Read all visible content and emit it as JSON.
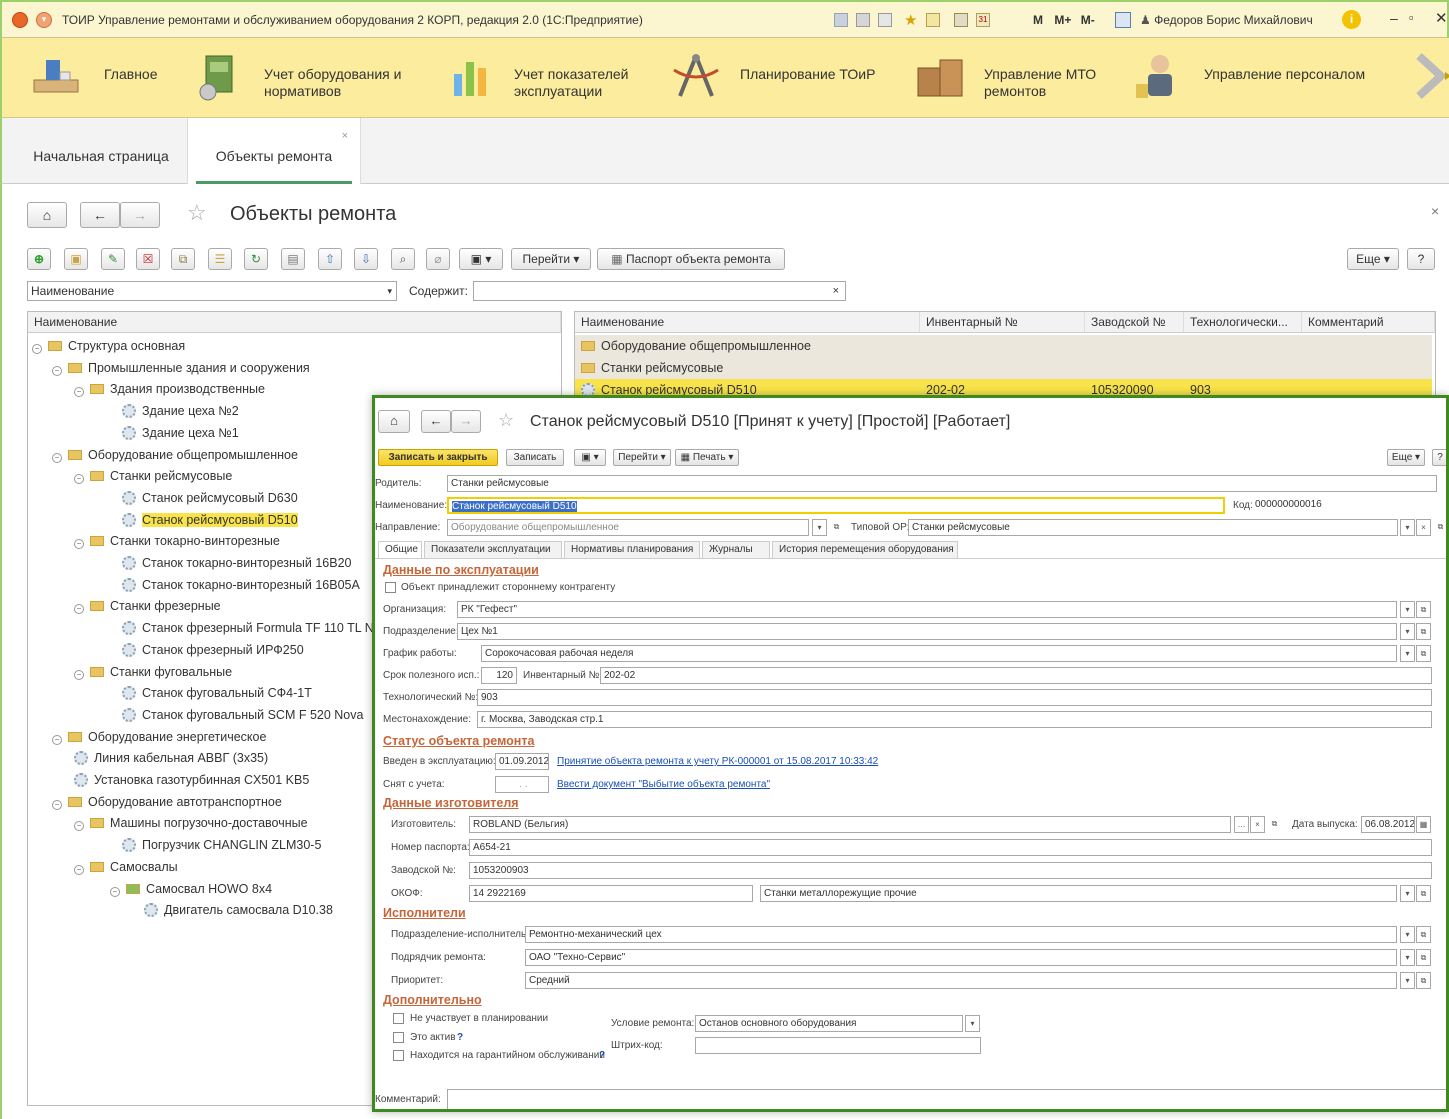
{
  "window": {
    "title": "ТОИР Управление ремонтами и обслуживанием оборудования 2 КОРП, редакция 2.0  (1С:Предприятие)",
    "user": "Федоров Борис Михайлович",
    "quick_buttons": [
      "M",
      "M+",
      "M-"
    ]
  },
  "sections": [
    {
      "label": "Главное"
    },
    {
      "label": "Учет оборудования и\nнормативов"
    },
    {
      "label": "Учет показателей\nэксплуатации"
    },
    {
      "label": "Планирование ТОиР"
    },
    {
      "label": "Управление МТО\nремонтов"
    },
    {
      "label": "Управление персоналом"
    }
  ],
  "tabs": [
    {
      "label": "Начальная страница"
    },
    {
      "label": "Объекты ремонта"
    }
  ],
  "page": {
    "title": "Объекты ремонта",
    "goto_button": "Перейти",
    "passport_button": "Паспорт объекта ремонта",
    "more_button": "Еще",
    "help_button": "?",
    "search_field": "Наименование",
    "contains_label": "Содержит:"
  },
  "tree": {
    "header": "Наименование",
    "items": [
      {
        "label": "Структура основная",
        "level": 0,
        "type": "root"
      },
      {
        "label": "Промышленные здания и сооружения",
        "level": 1,
        "type": "folder"
      },
      {
        "label": "Здания производственные",
        "level": 2,
        "type": "folder"
      },
      {
        "label": "Здание цеха №2",
        "level": 3,
        "type": "item"
      },
      {
        "label": "Здание цеха №1",
        "level": 3,
        "type": "item"
      },
      {
        "label": "Оборудование общепромышленное",
        "level": 1,
        "type": "folder"
      },
      {
        "label": "Станки рейсмусовые",
        "level": 2,
        "type": "folder"
      },
      {
        "label": "Станок рейсмусовый D630",
        "level": 3,
        "type": "item"
      },
      {
        "label": "Станок рейсмусовый D510",
        "level": 3,
        "type": "item",
        "selected": true
      },
      {
        "label": "Станки токарно-винторезные",
        "level": 2,
        "type": "folder"
      },
      {
        "label": "Станок токарно-винторезный 16В20",
        "level": 3,
        "type": "item"
      },
      {
        "label": "Станок токарно-винторезный 16В05А",
        "level": 3,
        "type": "item"
      },
      {
        "label": "Станки фрезерные",
        "level": 2,
        "type": "folder"
      },
      {
        "label": "Станок фрезерный Formula TF 110 TL N",
        "level": 3,
        "type": "item"
      },
      {
        "label": "Станок фрезерный ИРФ250",
        "level": 3,
        "type": "item"
      },
      {
        "label": "Станки фуговальные",
        "level": 2,
        "type": "folder"
      },
      {
        "label": "Станок фуговальный СФ4-1Т",
        "level": 3,
        "type": "item"
      },
      {
        "label": "Станок фуговальный SCM F 520 Nova",
        "level": 3,
        "type": "item"
      },
      {
        "label": "Оборудование энергетическое",
        "level": 1,
        "type": "folder"
      },
      {
        "label": "Линия кабельная АВВГ (3х35)",
        "level": 2,
        "type": "item"
      },
      {
        "label": "Установка газотурбинная CX501 KB5",
        "level": 2,
        "type": "item"
      },
      {
        "label": "Оборудование автотранспортное",
        "level": 1,
        "type": "folder"
      },
      {
        "label": "Машины погрузочно-доставочные",
        "level": 2,
        "type": "folder"
      },
      {
        "label": "Погрузчик CHANGLIN ZLM30-5",
        "level": 3,
        "type": "item"
      },
      {
        "label": "Самосвалы",
        "level": 2,
        "type": "folder"
      },
      {
        "label": "Самосвал HOWO 8x4",
        "level": 3,
        "type": "vehicle"
      },
      {
        "label": "Двигатель самосвала D10.38",
        "level": 4,
        "type": "item"
      }
    ]
  },
  "list": {
    "headers": [
      "Наименование",
      "Инвентарный №",
      "Заводской №",
      "Технологически...",
      "Комментарий"
    ],
    "rows": [
      {
        "name": "Оборудование общепромышленное",
        "inv": "",
        "factory": "",
        "tech": "",
        "comment": "",
        "type": "folder"
      },
      {
        "name": "Станки рейсмусовые",
        "inv": "",
        "factory": "",
        "tech": "",
        "comment": "",
        "type": "folder"
      },
      {
        "name": "Станок рейсмусовый D510",
        "inv": "202-02",
        "factory": "105320090",
        "tech": "903",
        "comment": "",
        "type": "item",
        "selected": true
      }
    ]
  },
  "form": {
    "title": "Станок рейсмусовый D510 [Принят к учету] [Простой] [Работает]",
    "save_close": "Записать и закрыть",
    "save": "Записать",
    "goto": "Перейти",
    "print": "Печать",
    "more": "Еще",
    "help": "?",
    "parent_label": "Родитель:",
    "parent_value": "Станки рейсмусовые",
    "name_label": "Наименование:",
    "name_value": "Станок рейсмусовый D510",
    "code_label": "Код:",
    "code_value": "000000000016",
    "direction_label": "Направление:",
    "direction_value": "Оборудование общепромышленное",
    "typical_label": "Типовой ОР:",
    "typical_value": "Станки рейсмусовые",
    "tabs": [
      "Общие",
      "Показатели эксплуатации",
      "Нормативы планирования",
      "Журналы",
      "История перемещения оборудования"
    ],
    "sec_operation": "Данные по эксплуатации",
    "third_party": "Объект принадлежит стороннему контрагенту",
    "org_label": "Организация:",
    "org_value": "РК \"Гефест\"",
    "dept_label": "Подразделение:",
    "dept_value": "Цех №1",
    "schedule_label": "График работы:",
    "schedule_value": "Сорокочасовая рабочая неделя",
    "life_label": "Срок полезного исп.:",
    "life_value": "120",
    "inv_label": "Инвентарный №:",
    "inv_value": "202-02",
    "tech_label": "Технологический №:",
    "tech_value": "903",
    "location_label": "Местонахождение:",
    "location_value": "г. Москва, Заводская стр.1",
    "sec_status": "Статус объекта ремонта",
    "commission_label": "Введен в эксплуатацию:",
    "commission_value": "01.09.2012",
    "commission_link": "Принятие объекта ремонта к учету РК-000001 от 15.08.2017 10:33:42",
    "removed_label": "Снят с учета:",
    "removed_value": ". .",
    "removed_link": "Ввести документ \"Выбытие объекта ремонта\"",
    "sec_maker": "Данные изготовителя",
    "maker_label": "Изготовитель:",
    "maker_value": "ROBLAND (Бельгия)",
    "release_label": "Дата выпуска:",
    "release_value": "06.08.2012",
    "passport_label": "Номер паспорта:",
    "passport_value": "А654-21",
    "factory_label": "Заводской №:",
    "factory_value": "1053200903",
    "okof_label": "ОКОФ:",
    "okof_code": "14 2922169",
    "okof_name": "Станки металлорежущие прочие",
    "sec_exec": "Исполнители",
    "exec_dept_label": "Подразделение-исполнитель:",
    "exec_dept_value": "Ремонтно-механический цех",
    "contractor_label": "Подрядчик ремонта:",
    "contractor_value": "ОАО \"Техно-Сервис\"",
    "priority_label": "Приоритет:",
    "priority_value": "Средний",
    "sec_extra": "Дополнительно",
    "no_planning": "Не участвует в планировании",
    "is_asset": "Это актив",
    "warranty": "Находится на гарантийном обслуживании",
    "repair_cond_label": "Условие ремонта:",
    "repair_cond_value": "Останов основного оборудования",
    "barcode_label": "Штрих-код:",
    "comment_label": "Комментарий:"
  }
}
